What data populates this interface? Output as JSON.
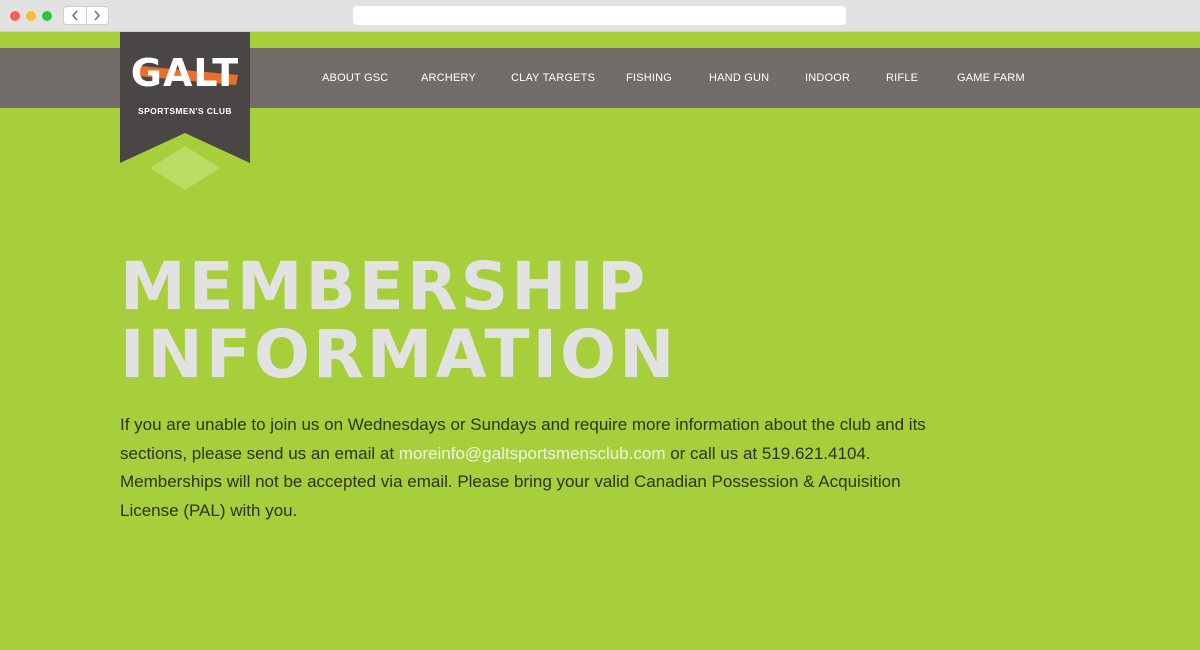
{
  "nav": {
    "items": [
      {
        "label": "ABOUT GSC"
      },
      {
        "label": "ARCHERY"
      },
      {
        "label": "CLAY TARGETS"
      },
      {
        "label": "FISHING"
      },
      {
        "label": "HAND GUN"
      },
      {
        "label": "INDOOR"
      },
      {
        "label": "RIFLE"
      },
      {
        "label": "GAME FARM"
      }
    ]
  },
  "logo": {
    "main": "GALT",
    "sub": "SPORTSMEN'S CLUB"
  },
  "main": {
    "heading_line1": "MEMBERSHIP",
    "heading_line2": "INFORMATION",
    "body_before_email": "If you are unable to join us on Wednesdays or Sundays and require more information about the club and its sections, please send us an email at ",
    "email": "moreinfo@galtsportsmensclub.com",
    "body_after_email": " or call us at 519.621.4104. Memberships will not be accepted via email. Please bring your valid Canadian Possession & Acquisition License (PAL) with you."
  },
  "colors": {
    "page_background": "#a6cf3b",
    "navbar": "#736d6a",
    "logo_banner": "#4a4645",
    "logo_accent": "#e8702a",
    "heading": "#e2e2e2",
    "link": "#eef4dd"
  }
}
